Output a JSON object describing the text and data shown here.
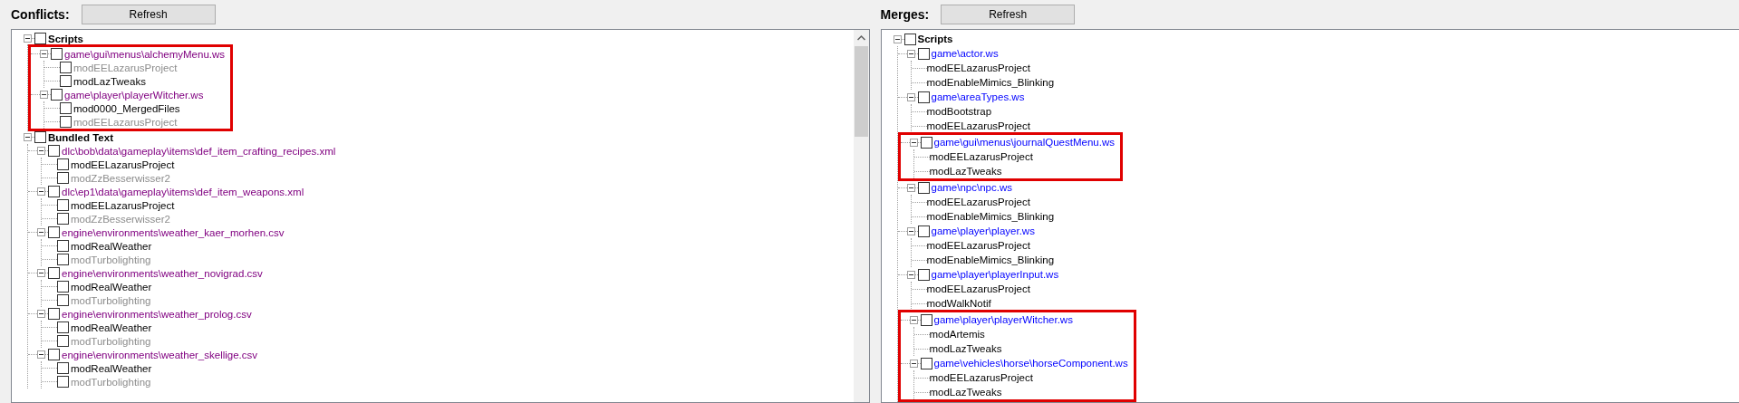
{
  "panels": [
    {
      "kind": "conflicts",
      "label": "Conflicts:",
      "button": "Refresh",
      "scrollbar": true,
      "categories": [
        {
          "label": "Scripts",
          "expanded": true,
          "checked": false,
          "files": [
            {
              "path": "game\\gui\\menus\\alchemyMenu.ws",
              "expanded": true,
              "checked": false,
              "highlighted": true,
              "mods": [
                {
                  "name": "modEELazarusProject",
                  "checked": false,
                  "dimmed": true
                },
                {
                  "name": "modLazTweaks",
                  "checked": false,
                  "dimmed": false
                }
              ]
            },
            {
              "path": "game\\player\\playerWitcher.ws",
              "expanded": true,
              "checked": false,
              "highlighted": true,
              "mods": [
                {
                  "name": "mod0000_MergedFiles",
                  "checked": false,
                  "dimmed": false
                },
                {
                  "name": "modEELazarusProject",
                  "checked": false,
                  "dimmed": true
                }
              ]
            }
          ]
        },
        {
          "label": "Bundled Text",
          "expanded": true,
          "checked": false,
          "files": [
            {
              "path": "dlc\\bob\\data\\gameplay\\items\\def_item_crafting_recipes.xml",
              "expanded": true,
              "checked": false,
              "highlighted": false,
              "mods": [
                {
                  "name": "modEELazarusProject",
                  "checked": false,
                  "dimmed": false
                },
                {
                  "name": "modZzBesserwisser2",
                  "checked": false,
                  "dimmed": true
                }
              ]
            },
            {
              "path": "dlc\\ep1\\data\\gameplay\\items\\def_item_weapons.xml",
              "expanded": true,
              "checked": false,
              "highlighted": false,
              "mods": [
                {
                  "name": "modEELazarusProject",
                  "checked": false,
                  "dimmed": false
                },
                {
                  "name": "modZzBesserwisser2",
                  "checked": false,
                  "dimmed": true
                }
              ]
            },
            {
              "path": "engine\\environments\\weather_kaer_morhen.csv",
              "expanded": true,
              "checked": false,
              "highlighted": false,
              "mods": [
                {
                  "name": "modRealWeather",
                  "checked": false,
                  "dimmed": false
                },
                {
                  "name": "modTurbolighting",
                  "checked": false,
                  "dimmed": true
                }
              ]
            },
            {
              "path": "engine\\environments\\weather_novigrad.csv",
              "expanded": true,
              "checked": false,
              "highlighted": false,
              "mods": [
                {
                  "name": "modRealWeather",
                  "checked": false,
                  "dimmed": false
                },
                {
                  "name": "modTurbolighting",
                  "checked": false,
                  "dimmed": true
                }
              ]
            },
            {
              "path": "engine\\environments\\weather_prolog.csv",
              "expanded": true,
              "checked": false,
              "highlighted": false,
              "mods": [
                {
                  "name": "modRealWeather",
                  "checked": false,
                  "dimmed": false
                },
                {
                  "name": "modTurbolighting",
                  "checked": false,
                  "dimmed": true
                }
              ]
            },
            {
              "path": "engine\\environments\\weather_skellige.csv",
              "expanded": true,
              "checked": false,
              "highlighted": false,
              "mods": [
                {
                  "name": "modRealWeather",
                  "checked": false,
                  "dimmed": false
                },
                {
                  "name": "modTurbolighting",
                  "checked": false,
                  "dimmed": true
                }
              ]
            }
          ]
        }
      ]
    },
    {
      "kind": "merges",
      "label": "Merges:",
      "button": "Refresh",
      "scrollbar": false,
      "categories": [
        {
          "label": "Scripts",
          "expanded": true,
          "checked": false,
          "files": [
            {
              "path": "game\\actor.ws",
              "expanded": true,
              "checked": false,
              "highlighted": false,
              "mods": [
                {
                  "name": "modEELazarusProject"
                },
                {
                  "name": "modEnableMimics_Blinking"
                }
              ]
            },
            {
              "path": "game\\areaTypes.ws",
              "expanded": true,
              "checked": false,
              "highlighted": false,
              "mods": [
                {
                  "name": "modBootstrap"
                },
                {
                  "name": "modEELazarusProject"
                }
              ]
            },
            {
              "path": "game\\gui\\menus\\journalQuestMenu.ws",
              "expanded": true,
              "checked": false,
              "highlighted": true,
              "mods": [
                {
                  "name": "modEELazarusProject"
                },
                {
                  "name": "modLazTweaks"
                }
              ]
            },
            {
              "path": "game\\npc\\npc.ws",
              "expanded": true,
              "checked": false,
              "highlighted": false,
              "mods": [
                {
                  "name": "modEELazarusProject"
                },
                {
                  "name": "modEnableMimics_Blinking"
                }
              ]
            },
            {
              "path": "game\\player\\player.ws",
              "expanded": true,
              "checked": false,
              "highlighted": false,
              "mods": [
                {
                  "name": "modEELazarusProject"
                },
                {
                  "name": "modEnableMimics_Blinking"
                }
              ]
            },
            {
              "path": "game\\player\\playerInput.ws",
              "expanded": true,
              "checked": false,
              "highlighted": false,
              "mods": [
                {
                  "name": "modEELazarusProject"
                },
                {
                  "name": "modWalkNotif"
                }
              ]
            },
            {
              "path": "game\\player\\playerWitcher.ws",
              "expanded": true,
              "checked": false,
              "highlighted": true,
              "mods": [
                {
                  "name": "modArtemis"
                },
                {
                  "name": "modLazTweaks"
                }
              ]
            },
            {
              "path": "game\\vehicles\\horse\\horseComponent.ws",
              "expanded": true,
              "checked": false,
              "highlighted": true,
              "mods": [
                {
                  "name": "modEELazarusProject"
                },
                {
                  "name": "modLazTweaks"
                }
              ]
            }
          ]
        }
      ]
    }
  ]
}
